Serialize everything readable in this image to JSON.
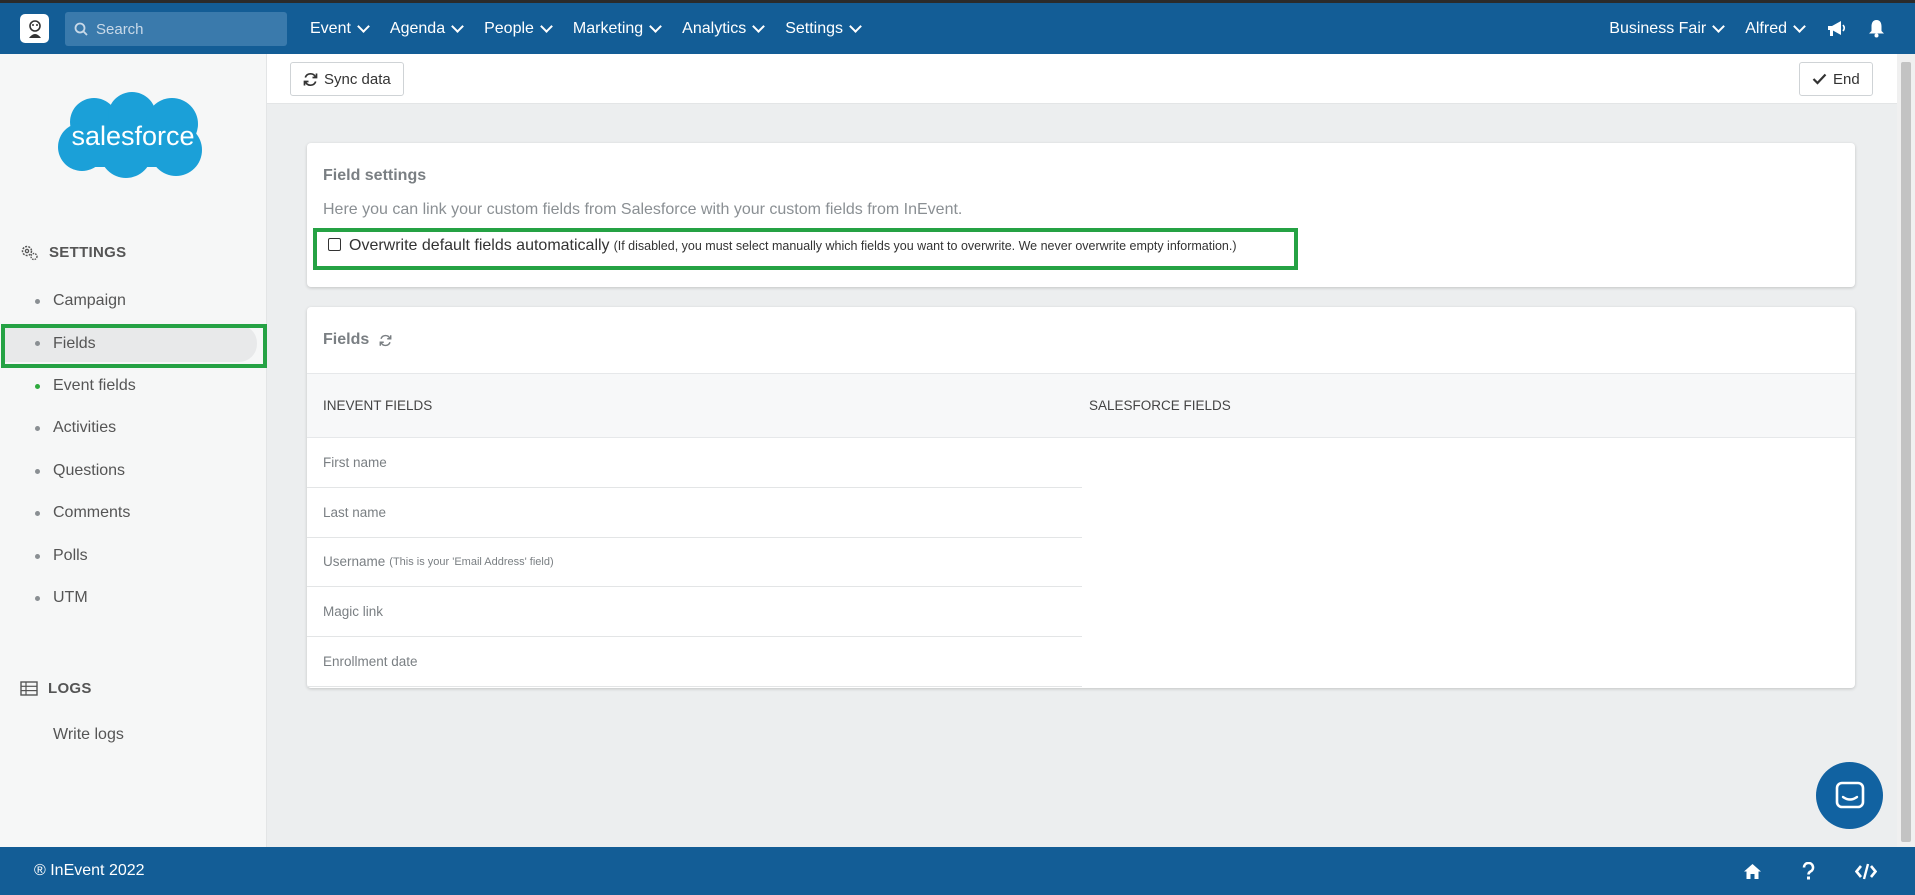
{
  "topbar": {
    "search_placeholder": "Search",
    "nav": [
      "Event",
      "Agenda",
      "People",
      "Marketing",
      "Analytics",
      "Settings"
    ],
    "event_selector": "Business Fair",
    "user_menu": "Alfred"
  },
  "sidebar": {
    "logo_text": "salesforce",
    "settings_heading": "SETTINGS",
    "settings_items": [
      "Campaign",
      "Fields",
      "Event fields",
      "Activities",
      "Questions",
      "Comments",
      "Polls",
      "UTM"
    ],
    "logs_heading": "LOGS",
    "logs_items": [
      "Write logs"
    ]
  },
  "toolbar": {
    "sync_label": "Sync data",
    "end_label": "End"
  },
  "field_settings": {
    "title": "Field settings",
    "description": "Here you can link your custom fields from Salesforce with your custom fields from InEvent.",
    "checkbox_label": "Overwrite default fields automatically",
    "checkbox_note": "(If disabled, you must select manually which fields you want to overwrite. We never overwrite empty information.)",
    "checkbox_checked": false
  },
  "fields": {
    "title": "Fields",
    "col_inevent": "INEVENT FIELDS",
    "col_salesforce": "SALESFORCE FIELDS",
    "rows": [
      {
        "label": "First name",
        "note": ""
      },
      {
        "label": "Last name",
        "note": ""
      },
      {
        "label": "Username",
        "note": "(This is your 'Email Address' field)"
      },
      {
        "label": "Magic link",
        "note": ""
      },
      {
        "label": "Enrollment date",
        "note": ""
      }
    ]
  },
  "footer": {
    "copyright": "® InEvent 2022"
  },
  "colors": {
    "brand_blue": "#135d96",
    "highlight_green": "#25a244",
    "salesforce_blue": "#1ba0d8"
  }
}
